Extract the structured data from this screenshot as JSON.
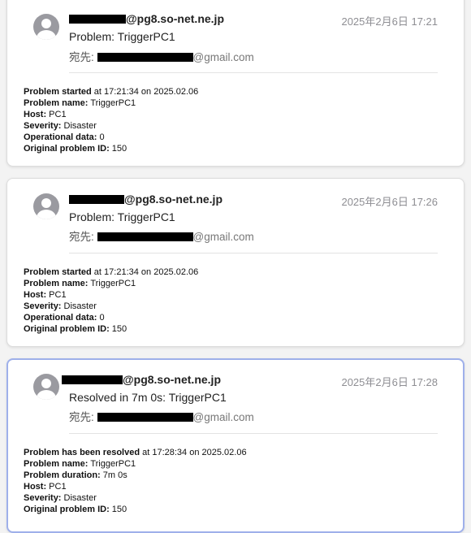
{
  "emails": [
    {
      "sender_domain": "@pg8.so-net.ne.jp",
      "date": "2025年2月6日 17:21",
      "subject": "Problem: TriggerPC1",
      "to_label": "宛先:",
      "to_domain": "@gmail.com",
      "body": [
        {
          "label": "Problem started",
          "value": " at 17:21:34 on 2025.02.06"
        },
        {
          "label": "Problem name:",
          "value": " TriggerPC1"
        },
        {
          "label": "Host:",
          "value": " PC1"
        },
        {
          "label": "Severity:",
          "value": " Disaster"
        },
        {
          "label": "Operational data:",
          "value": " 0"
        },
        {
          "label": "Original problem ID:",
          "value": " 150"
        }
      ]
    },
    {
      "sender_domain": "@pg8.so-net.ne.jp",
      "date": "2025年2月6日 17:26",
      "subject": "Problem: TriggerPC1",
      "to_label": "宛先:",
      "to_domain": "@gmail.com",
      "body": [
        {
          "label": "Problem started",
          "value": " at 17:21:34 on 2025.02.06"
        },
        {
          "label": "Problem name:",
          "value": " TriggerPC1"
        },
        {
          "label": "Host:",
          "value": " PC1"
        },
        {
          "label": "Severity:",
          "value": " Disaster"
        },
        {
          "label": "Operational data:",
          "value": " 0"
        },
        {
          "label": "Original problem ID:",
          "value": " 150"
        }
      ]
    },
    {
      "sender_domain": "@pg8.so-net.ne.jp",
      "date": "2025年2月6日 17:28",
      "subject": "Resolved in 7m 0s: TriggerPC1",
      "to_label": "宛先:",
      "to_domain": "@gmail.com",
      "body": [
        {
          "label": "Problem has been resolved",
          "value": " at 17:28:34 on 2025.02.06"
        },
        {
          "label": "Problem name:",
          "value": " TriggerPC1"
        },
        {
          "label": "Problem duration:",
          "value": " 7m 0s"
        },
        {
          "label": "Host:",
          "value": " PC1"
        },
        {
          "label": "Severity:",
          "value": " Disaster"
        },
        {
          "label": "Original problem ID:",
          "value": " 150"
        }
      ]
    }
  ],
  "colors": {
    "selected_border": "#9fb0ea",
    "date_gray": "#8e8e93",
    "redaction": "#000000"
  }
}
